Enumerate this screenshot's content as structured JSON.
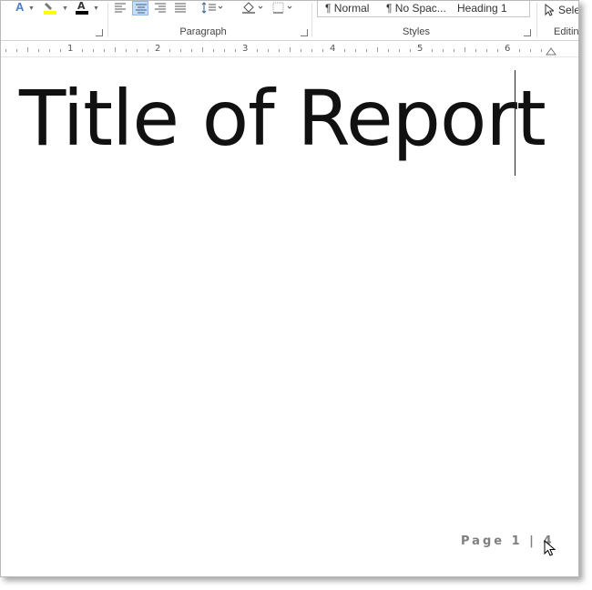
{
  "ribbon": {
    "groups": {
      "paragraph": "Paragraph",
      "styles": "Styles",
      "editing": "Editin"
    },
    "styles_gallery": {
      "items": [
        "¶ Normal",
        "¶ No Spac...",
        "Heading 1"
      ]
    },
    "select_label": "Sele",
    "icons": [
      "text-effects-icon",
      "highlight-icon",
      "font-color-icon",
      "align-left-icon",
      "align-center-icon",
      "align-right-icon",
      "justify-icon",
      "line-spacing-icon",
      "shading-icon",
      "borders-icon",
      "select-cursor-icon"
    ],
    "font_color": "#000000",
    "highlight_color": "#ffff00"
  },
  "ruler": {
    "numbers": [
      "1",
      "2",
      "3",
      "4",
      "5",
      "6"
    ]
  },
  "document": {
    "title": "Title of Report",
    "footer": {
      "page_text": "Page 1 | 4"
    }
  }
}
